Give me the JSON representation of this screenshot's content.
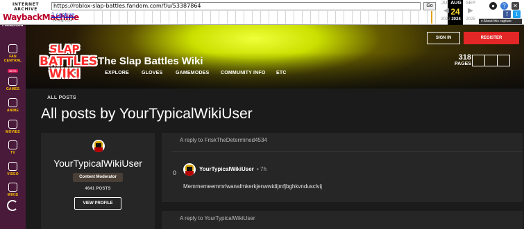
{
  "wayback": {
    "logo_top": "INTERNET ARCHIVE",
    "logo_main": "WaybackMachine",
    "url": "https://roblox-slap-battles.fandom.com/f/u/53387864",
    "go_label": "Go",
    "captures": "1 capture",
    "capture_date": "24 Aug 2024",
    "months": {
      "prev": "JUL",
      "current": "AUG",
      "next": "SEP"
    },
    "day": "24",
    "years": {
      "prev": "2023",
      "current": "2024",
      "next": "2025"
    },
    "about": "▾ About this capture",
    "colors": {
      "day_highlight": "#ffdd33",
      "capture_mark": "#e3a000"
    }
  },
  "rail": {
    "brand": "FANDOM",
    "items": [
      {
        "label": "FAN CENTRAL",
        "badge": "BETA"
      },
      {
        "label": "GAMES"
      },
      {
        "label": "ANIME"
      },
      {
        "label": "MOVIES"
      },
      {
        "label": "TV"
      },
      {
        "label": "VIDEO"
      },
      {
        "label": "WIKIS"
      }
    ]
  },
  "header": {
    "logo_lines": [
      "SLAP",
      "BATTLES",
      "WIKI"
    ],
    "wiki_name": "The Slap Battles Wiki",
    "nav": [
      "EXPLORE",
      "GLOVES",
      "GAMEMODES",
      "COMMUNITY INFO",
      "ETC"
    ],
    "sign_in": "SIGN IN",
    "register": "REGISTER",
    "pages_count": "318",
    "pages_label": "PAGES",
    "colors": {
      "register": "#e32626",
      "rail": "#4a1a3a",
      "rail_label": "#ffc500"
    }
  },
  "main": {
    "breadcrumb": "ALL POSTS",
    "title": "All posts by YourTypicalWikiUser",
    "profile": {
      "username": "YourTypicalWikiUser",
      "role": "Content Moderator",
      "posts": "4641 POSTS",
      "view_profile": "VIEW PROFILE"
    },
    "posts": [
      {
        "reply_to": "A reply to FriskTheDetermined4534",
        "votes": "0",
        "author": "YourTypicalWikiUser",
        "time": "• 7h",
        "body": "Memmemeemmrlwanafmkerkjenwwidijmfjbghkvndusclvij"
      },
      {
        "reply_to": "A reply to YourTypicalWikiUser"
      }
    ]
  }
}
